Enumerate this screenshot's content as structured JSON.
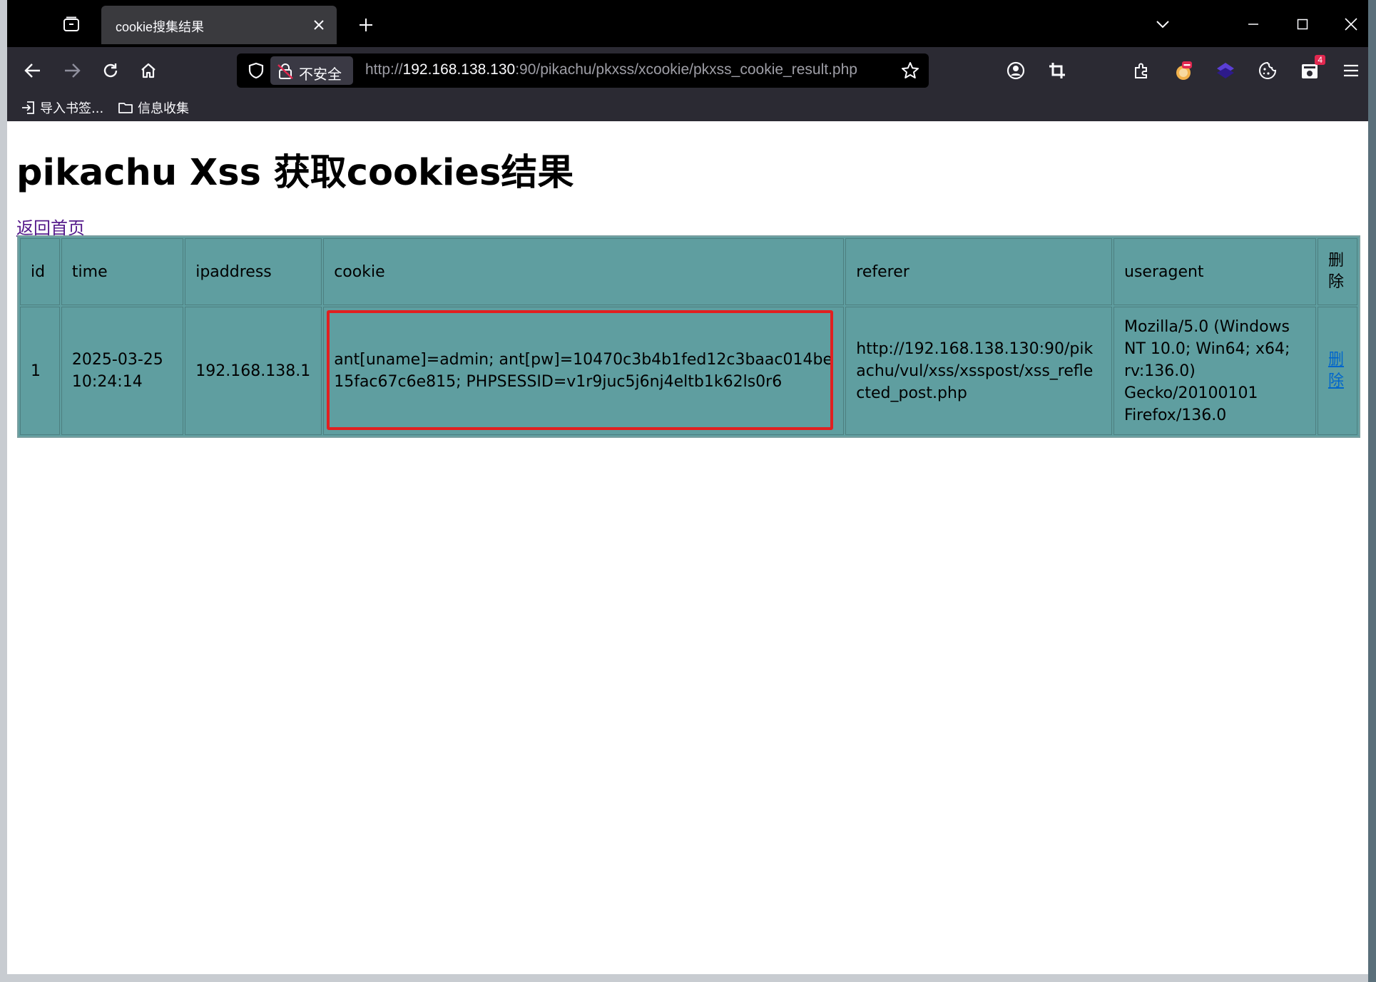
{
  "browser": {
    "tab": {
      "title": "cookie搜集结果"
    },
    "url": {
      "security_label": "不安全",
      "prefix": "http://",
      "host": "192.168.138.130",
      "rest": ":90/pikachu/pkxss/xcookie/pkxss_cookie_result.php"
    },
    "bookmarks": [
      {
        "label": "导入书签..."
      },
      {
        "label": "信息收集"
      }
    ],
    "extension_badge": "4"
  },
  "page": {
    "heading": "pikachu Xss 获取cookies结果",
    "home_link": "返回首页",
    "table": {
      "headers": [
        "id",
        "time",
        "ipaddress",
        "cookie",
        "referer",
        "useragent",
        "删除"
      ],
      "rows": [
        {
          "id": "1",
          "time": "2025-03-25 10:24:14",
          "ipaddress": "192.168.138.1",
          "cookie": "ant[uname]=admin; ant[pw]=10470c3b4b1fed12c3baac014be15fac67c6e815; PHPSESSID=v1r9juc5j6nj4eltb1k62ls0r6",
          "referer": "http://192.168.138.130:90/pikachu/vul/xss/xsspost/xss_reflected_post.php",
          "useragent": "Mozilla/5.0 (Windows NT 10.0; Win64; x64; rv:136.0) Gecko/20100101 Firefox/136.0",
          "delete": "删除"
        }
      ]
    }
  },
  "colors": {
    "table_bg": "#5f9ea0",
    "highlight": "#e02020",
    "visited_link": "#551a8b",
    "delete_link": "#0066cc"
  }
}
